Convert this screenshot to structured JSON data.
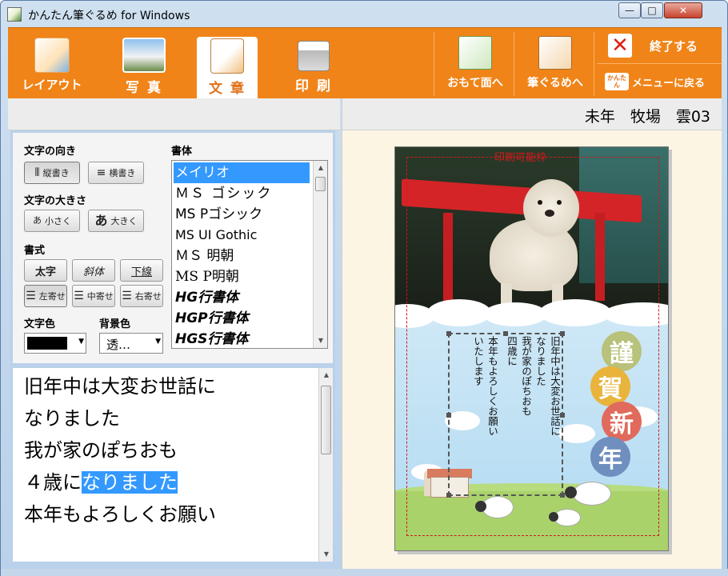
{
  "window": {
    "title": "かんたん筆ぐるめ for Windows",
    "minimize_glyph": "—",
    "maximize_glyph": "□",
    "close_glyph": "✕"
  },
  "toolbar": {
    "tabs": [
      {
        "label": "レイアウト",
        "icon": "layout-icon"
      },
      {
        "label": "写 真",
        "icon": "photo-icon"
      },
      {
        "label": "文 章",
        "icon": "text-icon"
      },
      {
        "label": "印 刷",
        "icon": "printer-icon"
      }
    ],
    "active_tab": "文 章",
    "front_label": "おもて面へ",
    "fude_label": "筆ぐるめへ",
    "exit_label": "終了する",
    "exit_glyph": "✕",
    "menu_label": "メニューに戻る",
    "menu_icon_text": "かんたん"
  },
  "controls": {
    "direction_heading": "文字の向き",
    "direction_options": [
      "縦書き",
      "横書き"
    ],
    "size_heading": "文字の大きさ",
    "size_options": [
      "小さく",
      "大きく"
    ],
    "style_heading": "書式",
    "style_options": [
      "太字",
      "斜体",
      "下線"
    ],
    "align_options": [
      "左寄せ",
      "中寄せ",
      "右寄せ"
    ],
    "textcolor_heading": "文字色",
    "textcolor_value": "#000000",
    "bgcolor_heading": "背景色",
    "bgcolor_value": "透…",
    "font_heading": "書体",
    "fonts": [
      "メイリオ",
      "ＭＳ ゴシック",
      "MS Pゴシック",
      "MS UI Gothic",
      "ＭＳ 明朝",
      "MS P明朝",
      "HG行書体",
      "HGP行書体",
      "HGS行書体"
    ],
    "selected_font": "メイリオ"
  },
  "editor": {
    "lines": [
      {
        "plain": "旧年中は大変お世話に",
        "highlighted": ""
      },
      {
        "plain": "なりました",
        "highlighted": ""
      },
      {
        "plain": "我が家のぽちおも",
        "highlighted": ""
      },
      {
        "plain": "４歳に",
        "highlighted": "なりました"
      },
      {
        "plain": "本年もよろしくお願い",
        "highlighted": ""
      }
    ]
  },
  "preview": {
    "header_title": "未年　牧場　雲03",
    "print_frame_label": "印刷可能枠",
    "card_text_columns": [
      "旧年中は大変お世話に",
      "なりました",
      "我が家のぽちおも",
      "四歳に",
      "本年もよろしくお願い",
      "いたします"
    ],
    "kanji": [
      {
        "char": "謹",
        "color": "#b8c27a"
      },
      {
        "char": "賀",
        "color": "#e8b43c"
      },
      {
        "char": "新",
        "color": "#e06a5c"
      },
      {
        "char": "年",
        "color": "#6f8fbf"
      }
    ]
  }
}
